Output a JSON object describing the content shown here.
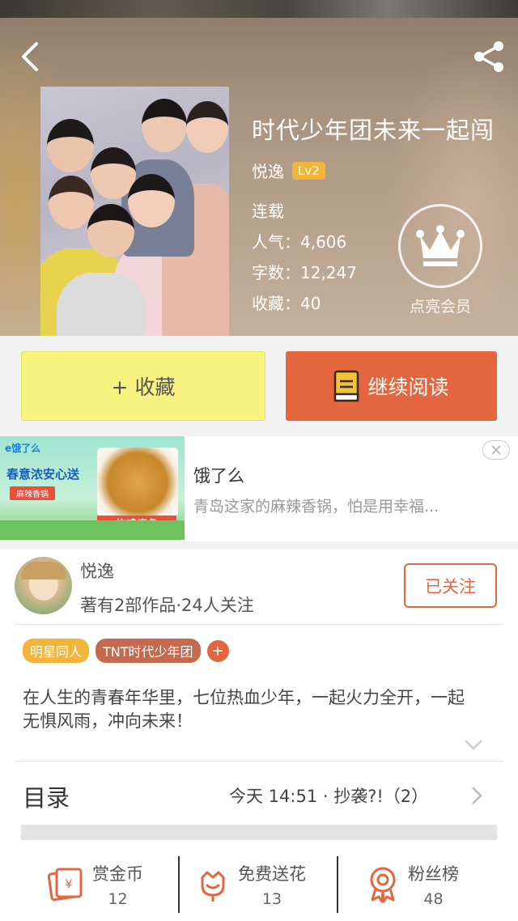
{
  "book": {
    "title": "时代少年团未来一起闯",
    "author": "悦逸",
    "level": "Lv2",
    "status": "连载",
    "popularity": "人气：4,606",
    "word_count": "字数：12,247",
    "favorites": "收藏：40",
    "vip_label": "点亮会员"
  },
  "actions": {
    "collect_label": "+ 收藏",
    "read_label": "继续阅读"
  },
  "ad": {
    "title": "饿了么",
    "description": "青岛这家的麻辣香锅，怕是用幸福...",
    "image_texts": {
      "brand": "e饿了么",
      "headline": "春意浓安心送",
      "sub": "麻辣香锅",
      "dish": "炸鸡柳条"
    }
  },
  "author_card": {
    "name": "悦逸",
    "summary": "著有2部作品·24人关注",
    "follow_label": "已关注"
  },
  "tags": [
    {
      "label": "明星同人",
      "color": "#f3b43a"
    },
    {
      "label": "TNT时代少年团",
      "color": "#c46a4f"
    }
  ],
  "tag_add": "+",
  "intro": "在人生的青春年华里，七位热血少年，一起火力全开，一起无惧风雨，冲向未来！",
  "toc": {
    "label": "目录",
    "latest": "今天 14:51 · 抄袭?!（2）"
  },
  "bottom": [
    {
      "label": "赏金币",
      "value": "12",
      "icon": "reward-coin-icon"
    },
    {
      "label": "免费送花",
      "value": "13",
      "icon": "flower-icon"
    },
    {
      "label": "粉丝榜",
      "value": "48",
      "icon": "medal-icon"
    }
  ],
  "colors": {
    "accent": "#e4663e",
    "collect_bg": "#f8f281",
    "badge": "#f3b43a"
  }
}
